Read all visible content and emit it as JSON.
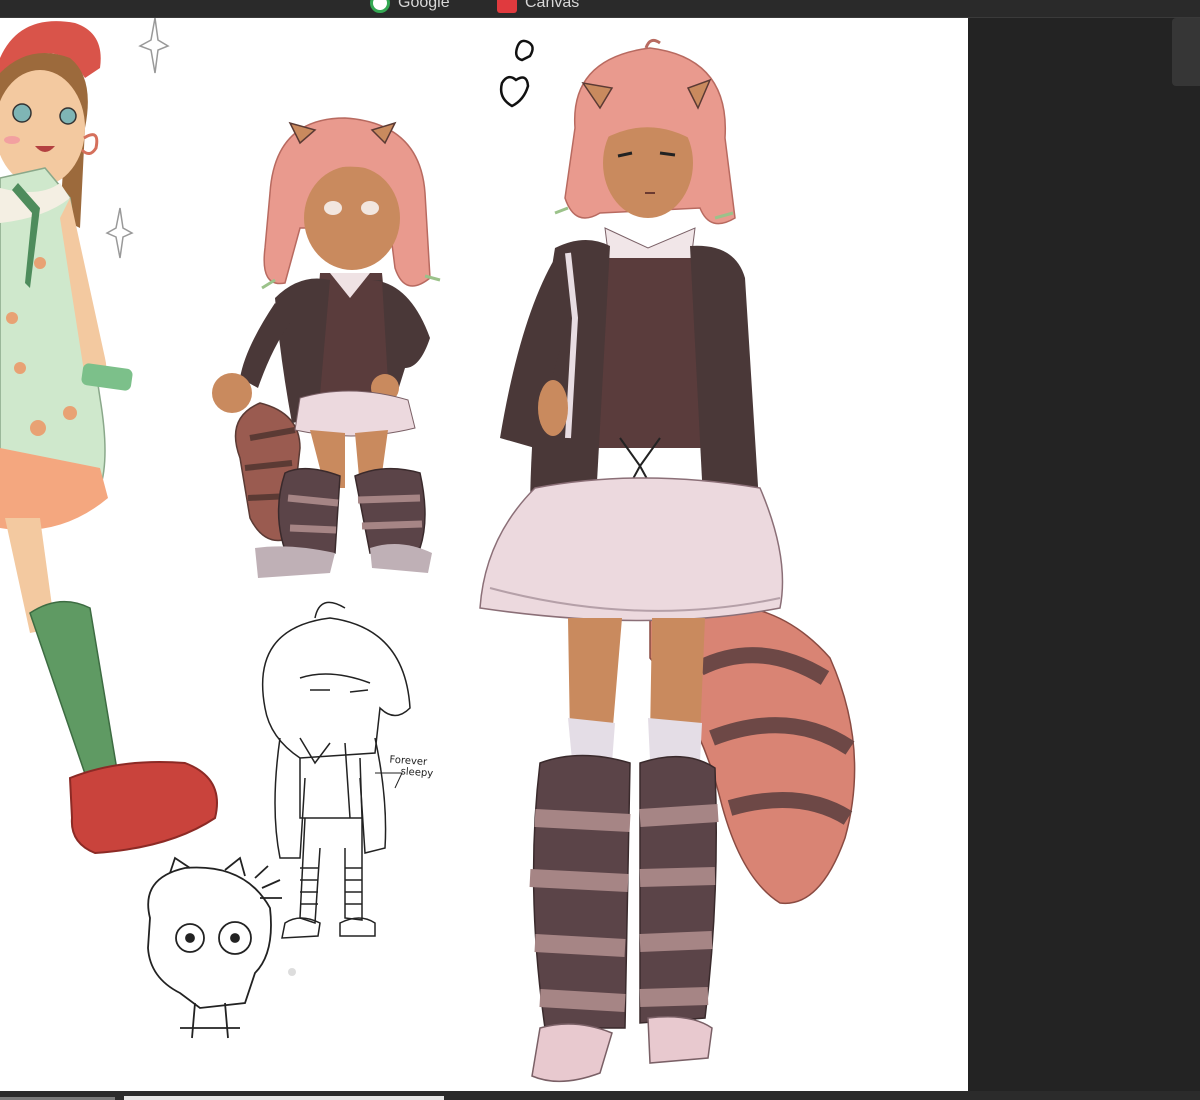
{
  "browser": {
    "bookmarks": [
      {
        "label": "Google",
        "icon": "google-icon",
        "color": "#34a853"
      },
      {
        "label": "Canvas",
        "icon": "canvas-icon",
        "color": "#e03a3e"
      }
    ]
  },
  "artwork": {
    "annotation_line1": "Forever",
    "annotation_line2": "sleepy",
    "colors": {
      "hair": "#e99a8e",
      "skin": "#c98a5e",
      "jacket": "#4a3838",
      "skirt": "#ecd9de",
      "fur_dark": "#5b4448",
      "fur_light": "#a68585",
      "tail": "#d98474",
      "dress": "#cfe8cc",
      "sock_green": "#5f9a63",
      "shoe_red": "#c9433c"
    }
  }
}
